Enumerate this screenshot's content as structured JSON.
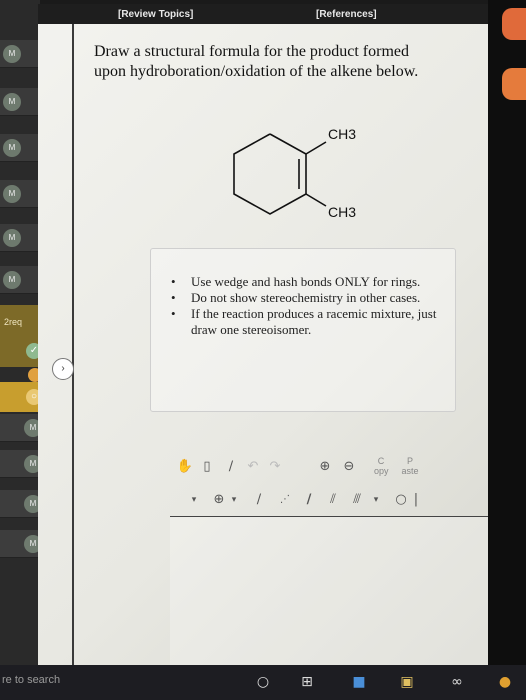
{
  "header": {
    "review_topics": "[Review Topics]",
    "references": "[References]"
  },
  "question": {
    "prompt": "Draw a structural formula for the product formed upon hydroboration/oxidation of the alkene below."
  },
  "molecule": {
    "substituent_top": "CH3",
    "substituent_bottom": "CH3"
  },
  "instructions": [
    "Use wedge and hash bonds ONLY for rings.",
    "Do not show stereochemistry in other cases.",
    "If the reaction produces a racemic mixture, just draw one stereoisomer."
  ],
  "left_rail": {
    "badge": "M",
    "active_label": "2req",
    "toggle_icon": "›"
  },
  "toolbar": {
    "copy_label": "C",
    "copy_sub": "opy",
    "paste_label": "P",
    "paste_sub": "aste"
  },
  "taskbar": {
    "search_placeholder": "re to search"
  },
  "colors": {
    "active_question": "#7d6a28",
    "accent_orange": "#e06a3a",
    "panel_bg": "#f1f1ed"
  }
}
